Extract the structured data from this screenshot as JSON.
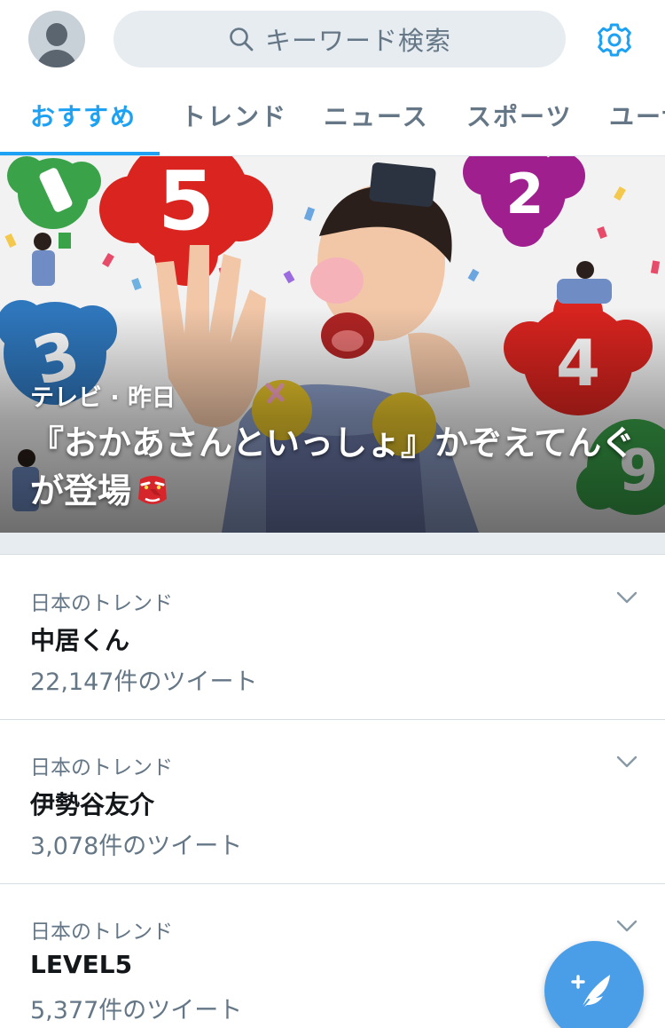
{
  "header": {
    "search_placeholder": "キーワード検索"
  },
  "tabs": [
    {
      "label": "おすすめ",
      "active": true
    },
    {
      "label": "トレンド",
      "active": false
    },
    {
      "label": "ニュース",
      "active": false
    },
    {
      "label": "スポーツ",
      "active": false
    },
    {
      "label": "ユーザー",
      "active": false
    }
  ],
  "hero": {
    "meta": "テレビ · 昨日",
    "title": "『おかあさんといっしょ』かぞえてんぐが登場",
    "title_emoji": "tengu-mask-icon",
    "image_description_icon": "tv-show-photo"
  },
  "trends": [
    {
      "context": "日本のトレンド",
      "name": "中居くん",
      "count": "22,147件のツイート"
    },
    {
      "context": "日本のトレンド",
      "name": "伊勢谷友介",
      "count": "3,078件のツイート"
    },
    {
      "context": "日本のトレンド",
      "name": "LEVEL5",
      "count": "5,377件のツイート"
    }
  ],
  "colors": {
    "accent": "#1da1f2",
    "fab": "#4a9ee8",
    "secondary_text": "#657786",
    "separator": "#e6ecf0"
  },
  "icons": {
    "avatar": "default-avatar-icon",
    "search": "search-icon",
    "settings": "gear-icon",
    "trend_menu": "chevron-down-icon",
    "compose": "compose-tweet-icon"
  }
}
